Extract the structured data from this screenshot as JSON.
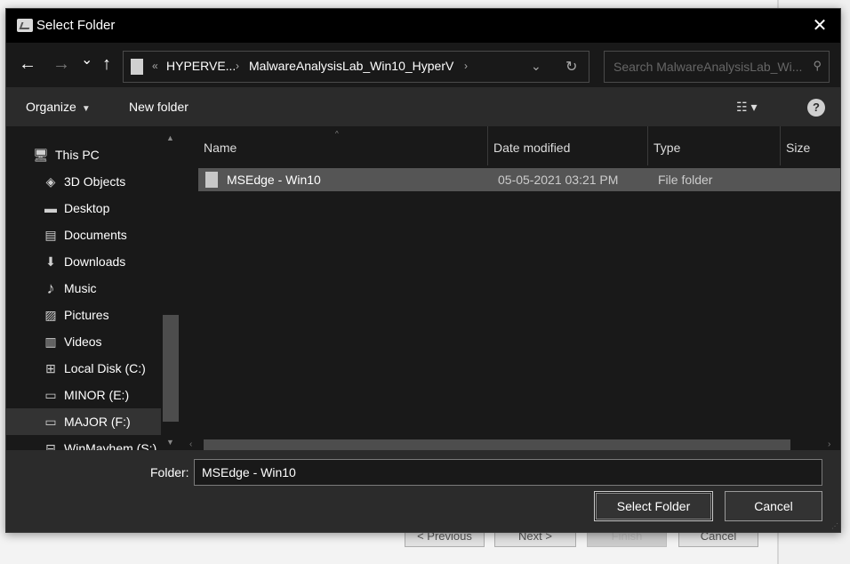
{
  "background_wizard": {
    "buttons": [
      {
        "label": "< Previous",
        "enabled": true
      },
      {
        "label": "Next >",
        "enabled": true
      },
      {
        "label": "Finish",
        "enabled": false
      },
      {
        "label": "Cancel",
        "enabled": true
      }
    ]
  },
  "dialog": {
    "title": "Select Folder",
    "close_glyph": "✕"
  },
  "nav": {
    "back_glyph": "←",
    "forward_glyph": "→",
    "recent_glyph": "⌄",
    "up_glyph": "↑",
    "overflow": "«",
    "breadcrumbs": [
      "HYPERVE...",
      "MalwareAnalysisLab_Win10_HyperV"
    ],
    "crumb_sep": "›",
    "dropdown_glyph": "⌄",
    "refresh_glyph": "↻",
    "search_placeholder": "Search MalwareAnalysisLab_Wi...",
    "search_glyph": "⚲"
  },
  "toolbar": {
    "organize_label": "Organize",
    "new_folder_label": "New folder",
    "caret": "▼",
    "view_glyph": "☷ ▾",
    "help_glyph": "?"
  },
  "navpane": {
    "items": [
      {
        "label": "This PC",
        "icon": "computer-icon",
        "glyph": "🖥"
      },
      {
        "label": "3D Objects",
        "icon": "cube-icon",
        "glyph": "◈"
      },
      {
        "label": "Desktop",
        "icon": "desktop-icon",
        "glyph": "▬"
      },
      {
        "label": "Documents",
        "icon": "document-icon",
        "glyph": "▤"
      },
      {
        "label": "Downloads",
        "icon": "download-icon",
        "glyph": "⬇"
      },
      {
        "label": "Music",
        "icon": "music-icon",
        "glyph": "♪"
      },
      {
        "label": "Pictures",
        "icon": "pictures-icon",
        "glyph": "▨"
      },
      {
        "label": "Videos",
        "icon": "video-icon",
        "glyph": "▥"
      },
      {
        "label": "Local Disk (C:)",
        "icon": "windows-drive-icon",
        "glyph": "⊞"
      },
      {
        "label": "MINOR (E:)",
        "icon": "drive-icon",
        "glyph": "▭"
      },
      {
        "label": "MAJOR (F:)",
        "icon": "drive-icon",
        "glyph": "▭"
      },
      {
        "label": "WinMayhem (S:)",
        "icon": "network-drive-icon",
        "glyph": "⊟"
      }
    ],
    "selected_index": 10,
    "scroll_up": "▲",
    "scroll_down": "▼"
  },
  "filelist": {
    "columns": [
      "Name",
      "Date modified",
      "Type",
      "Size"
    ],
    "sort_glyph": "^",
    "rows": [
      {
        "name": "MSEdge - Win10",
        "date": "05-05-2021 03:21 PM",
        "type": "File folder",
        "size": ""
      }
    ],
    "h_left": "‹",
    "h_right": "›"
  },
  "bottom": {
    "folder_label": "Folder:",
    "folder_value": "MSEdge - Win10",
    "select_label": "Select Folder",
    "cancel_label": "Cancel",
    "grip": "⋰"
  }
}
